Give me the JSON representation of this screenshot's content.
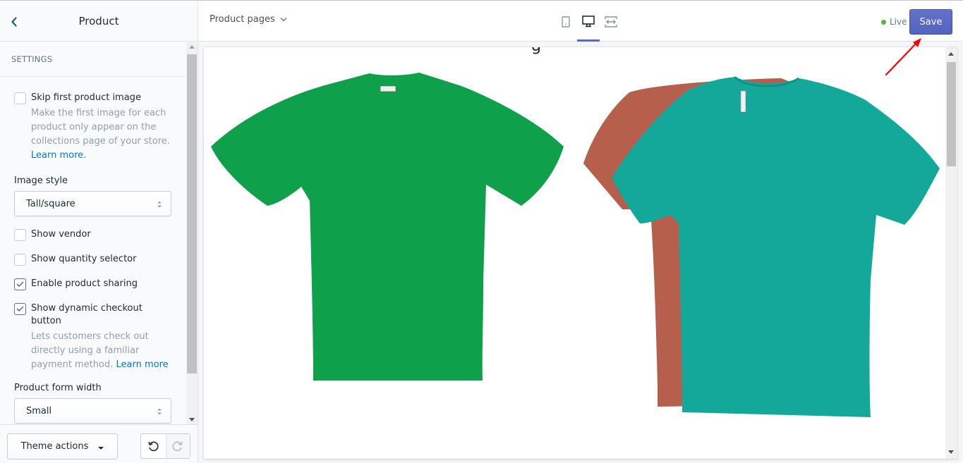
{
  "sidebar": {
    "title": "Product",
    "back_icon": "chevron-left-icon",
    "section_title": "SETTINGS",
    "settings": {
      "skip_first_image": {
        "label": "Skip first product image",
        "checked": false,
        "help": "Make the first image for each product only appear on the collections page of your store.",
        "help_link": "Learn more."
      },
      "image_style": {
        "label": "Image style",
        "value": "Tall/square"
      },
      "show_vendor": {
        "label": "Show vendor",
        "checked": false
      },
      "show_quantity": {
        "label": "Show quantity selector",
        "checked": false
      },
      "enable_sharing": {
        "label": "Enable product sharing",
        "checked": true
      },
      "dynamic_checkout": {
        "label": "Show dynamic checkout button",
        "checked": true,
        "help": "Lets customers check out directly using a familiar payment method.",
        "help_link": "Learn more"
      },
      "form_width": {
        "label": "Product form width",
        "value": "Small"
      }
    },
    "footer": {
      "theme_actions_label": "Theme actions",
      "undo_icon": "undo-icon",
      "redo_icon": "redo-icon"
    }
  },
  "topbar": {
    "page_select_label": "Product pages",
    "devices": [
      {
        "name": "mobile",
        "icon": "mobile-icon",
        "active": false
      },
      {
        "name": "desktop",
        "icon": "desktop-icon",
        "active": true
      },
      {
        "name": "fullscreen",
        "icon": "fullscreen-icon",
        "active": false
      }
    ],
    "status_label": "Live",
    "save_label": "Save"
  },
  "preview": {
    "images": [
      {
        "name": "green-tshirt",
        "color": "#0fa04c"
      },
      {
        "name": "rust-and-teal-tshirts",
        "colors": [
          "#b55f4c",
          "#14a89a"
        ]
      }
    ]
  },
  "colors": {
    "accent": "#5c6ac4",
    "live": "#50b83c",
    "link": "#007ace",
    "annotation": "#ff0000"
  }
}
